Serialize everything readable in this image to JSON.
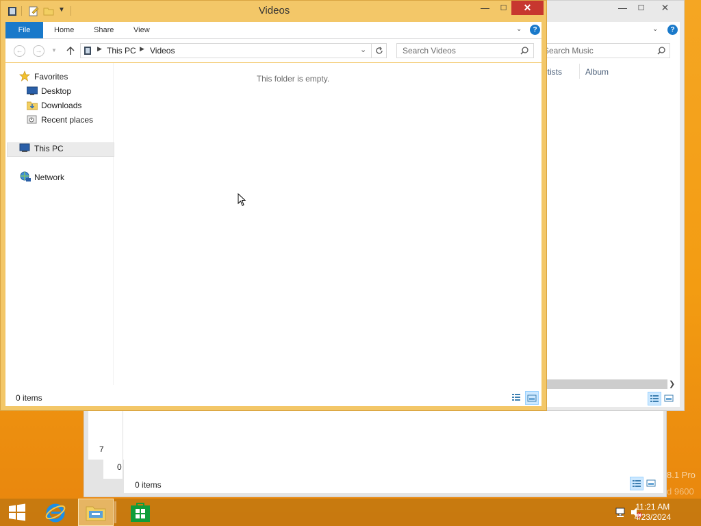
{
  "music_window": {
    "search_placeholder": "Search Music",
    "columns": [
      "artists",
      "Album"
    ],
    "status": "0 items"
  },
  "back_window": {
    "status": "0 items",
    "fragment_left_a": "7",
    "fragment_left_b": "0"
  },
  "videos_window": {
    "title": "Videos",
    "ribbon_tabs": {
      "file": "File",
      "home": "Home",
      "share": "Share",
      "view": "View"
    },
    "help": "?",
    "breadcrumb": {
      "pc": "This PC",
      "folder": "Videos"
    },
    "search_placeholder": "Search Videos",
    "nav": {
      "favorites": "Favorites",
      "desktop": "Desktop",
      "downloads": "Downloads",
      "recent": "Recent places",
      "this_pc": "This PC",
      "network": "Network"
    },
    "empty_message": "This folder is empty.",
    "status": "0 items"
  },
  "desktop_watermark": {
    "line1": "8.1 Pro",
    "line2": "d 9600"
  },
  "taskbar": {
    "clock_time": "11:21 AM",
    "clock_date": "4/23/2024"
  },
  "colors": {
    "accent": "#1979ca",
    "active_frame": "#f3c768",
    "close_red": "#c7372f",
    "desktop_orange": "#f39c12"
  },
  "icons": [
    "folder-icon",
    "properties-icon",
    "new-folder-icon",
    "back-arrow-icon",
    "forward-arrow-icon",
    "up-arrow-icon",
    "refresh-icon",
    "search-icon",
    "star-icon",
    "desktop-icon",
    "downloads-icon",
    "recent-places-icon",
    "computer-icon",
    "network-icon",
    "windows-start-icon",
    "internet-explorer-icon",
    "file-explorer-icon",
    "store-icon",
    "network-tray-icon",
    "speaker-muted-icon"
  ]
}
